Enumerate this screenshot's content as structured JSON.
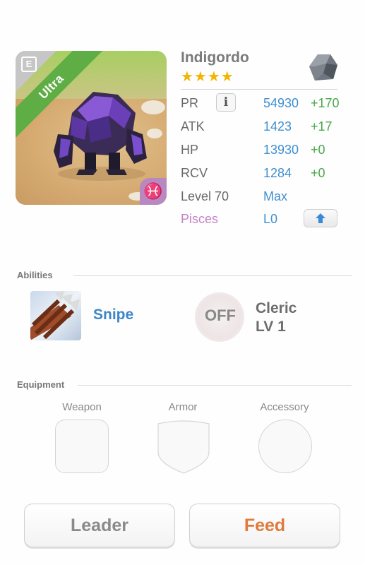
{
  "monster": {
    "name": "Indigordo",
    "stars": "★★★★",
    "rarity": "Ultra",
    "element_icon": "rock-gem-icon",
    "sign_glyph": "♓"
  },
  "stats": {
    "pr": {
      "label": "PR",
      "value": "54930",
      "plus": "+170",
      "info": "i"
    },
    "atk": {
      "label": "ATK",
      "value": "1423",
      "plus": "+17"
    },
    "hp": {
      "label": "HP",
      "value": "13930",
      "plus": "+0"
    },
    "rcv": {
      "label": "RCV",
      "value": "1284",
      "plus": "+0"
    },
    "level": {
      "label": "Level 70",
      "value": "Max"
    },
    "sign": {
      "label": "Pisces",
      "value": "L0",
      "label_color": "#c483c4"
    }
  },
  "abilities": {
    "title": "Abilities",
    "primary": {
      "name": "Snipe"
    },
    "secondary": {
      "state": "OFF",
      "name": "Cleric",
      "level": "LV 1"
    }
  },
  "equipment": {
    "title": "Equipment",
    "slots": [
      "Weapon",
      "Armor",
      "Accessory"
    ]
  },
  "buttons": {
    "leader": "Leader",
    "feed": "Feed"
  },
  "colors": {
    "value_blue": "#3f8fcf",
    "plus_green": "#4aa84a",
    "rarity_green": "#5fae45",
    "feed_orange": "#e0793a"
  }
}
